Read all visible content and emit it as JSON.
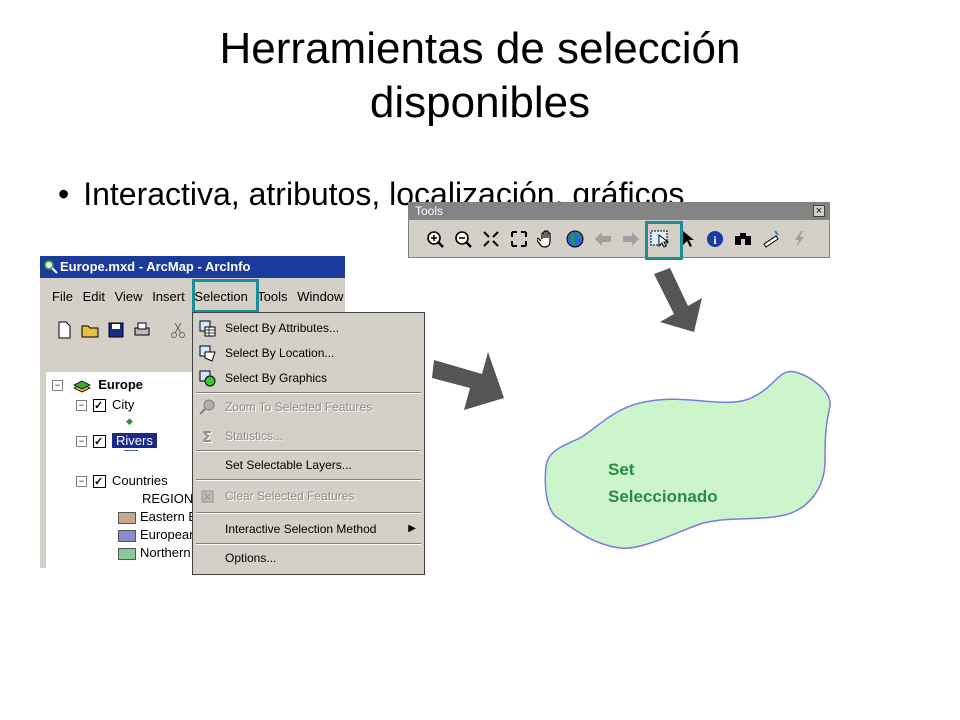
{
  "slide": {
    "title_line1": "Herramientas de selección",
    "title_line2": "disponibles",
    "bullet": "Interactiva, atributos, localización, gráficos"
  },
  "tools_toolbar": {
    "title": "Tools",
    "close": "×",
    "buttons": [
      "zoom-in-icon",
      "zoom-out-icon",
      "fixed-zoom-in-icon",
      "fixed-zoom-out-icon",
      "pan-hand-icon",
      "full-extent-globe-icon",
      "back-arrow-icon",
      "forward-arrow-icon",
      "select-features-icon",
      "select-elements-icon",
      "identify-icon",
      "find-binoculars-icon",
      "measure-icon",
      "hyperlink-icon"
    ],
    "highlighted": "select-features-icon"
  },
  "arcmap": {
    "window_title": "Europe.mxd - ArcMap - ArcInfo",
    "menu": [
      "File",
      "Edit",
      "View",
      "Insert",
      "Selection",
      "Tools",
      "Window"
    ],
    "menu_highlighted": "Selection",
    "toc": {
      "dataframe": "Europe",
      "layers": {
        "city": "City",
        "rivers": "Rivers",
        "countries": "Countries",
        "countries_field": "REGION",
        "legend": [
          {
            "label": "Eastern E",
            "color": "#c8a88a"
          },
          {
            "label": "European",
            "color": "#8a8ad0"
          },
          {
            "label": "Northern",
            "color": "#8ac896"
          }
        ]
      }
    }
  },
  "selection_menu": {
    "items": [
      {
        "label": "Select By Attributes...",
        "disabled": false
      },
      {
        "label": "Select By Location...",
        "disabled": false
      },
      {
        "label": "Select By Graphics",
        "disabled": false
      },
      {
        "label": "Zoom To Selected Features",
        "disabled": true
      },
      {
        "label": "Statistics...",
        "disabled": true
      },
      {
        "label": "Set Selectable Layers...",
        "disabled": false
      },
      {
        "label": "Clear Selected Features",
        "disabled": true
      },
      {
        "label": "Interactive Selection Method",
        "disabled": false,
        "submenu": true
      },
      {
        "label": "Options...",
        "disabled": false
      }
    ]
  },
  "result": {
    "label_line1": "Set",
    "label_line2": "Seleccionado",
    "fill": "#ccf5cc",
    "stroke": "#7a7ae0"
  },
  "colors": {
    "highlight_box": "#1e8c96",
    "arrow": "#555555",
    "titlebar": "#1a3a9c"
  }
}
